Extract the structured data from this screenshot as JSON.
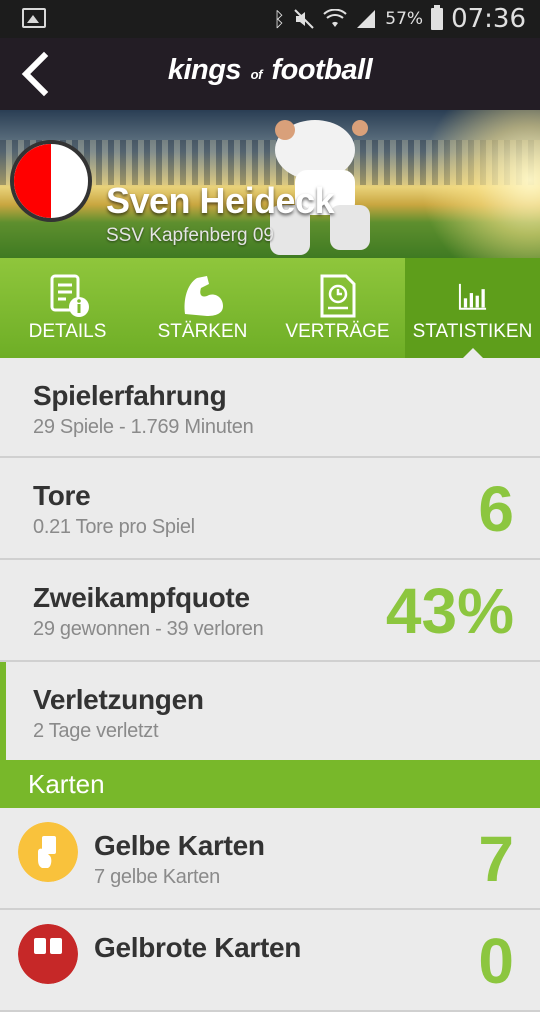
{
  "status_bar": {
    "battery": "57%",
    "time": "07:36",
    "icons": [
      "gallery-icon",
      "bluetooth-icon",
      "mute-icon",
      "wifi-icon",
      "signal-icon",
      "battery-icon"
    ]
  },
  "app_bar": {
    "logo_left": "kings",
    "logo_of": "of",
    "logo_right": "football"
  },
  "player": {
    "name": "Sven Heideck",
    "club": "SSV Kapfenberg 09",
    "club_colors": [
      "#ff0000",
      "#ffffff"
    ]
  },
  "tabs": [
    {
      "label": "DETAILS",
      "icon": "details-document-icon",
      "active": false
    },
    {
      "label": "STÄRKEN",
      "icon": "bicep-strength-icon",
      "active": false
    },
    {
      "label": "VERTRÄGE",
      "icon": "contract-clock-icon",
      "active": false
    },
    {
      "label": "STATISTIKEN",
      "icon": "statistics-chart-icon",
      "active": true
    }
  ],
  "stats": {
    "experience": {
      "title": "Spielerfahrung",
      "sub": "29 Spiele - 1.769 Minuten"
    },
    "goals": {
      "title": "Tore",
      "sub": "0.21 Tore pro Spiel",
      "value": "6"
    },
    "duels": {
      "title": "Zweikampfquote",
      "sub": "29 gewonnen - 39 verloren",
      "value": "43%"
    },
    "injuries": {
      "title": "Verletzungen",
      "sub": "2 Tage verletzt"
    }
  },
  "cards_section": {
    "header": "Karten",
    "yellow": {
      "title": "Gelbe Karten",
      "sub": "7 gelbe Karten",
      "value": "7",
      "color": "#f9c23c"
    },
    "yellow_red": {
      "title": "Gelbrote Karten",
      "value": "0",
      "color": "#c62828"
    }
  },
  "colors": {
    "accent": "#8cc63f",
    "tab_bg": "#7dba2e",
    "tab_active": "#5e9e1b",
    "app_bar": "#231d25"
  }
}
